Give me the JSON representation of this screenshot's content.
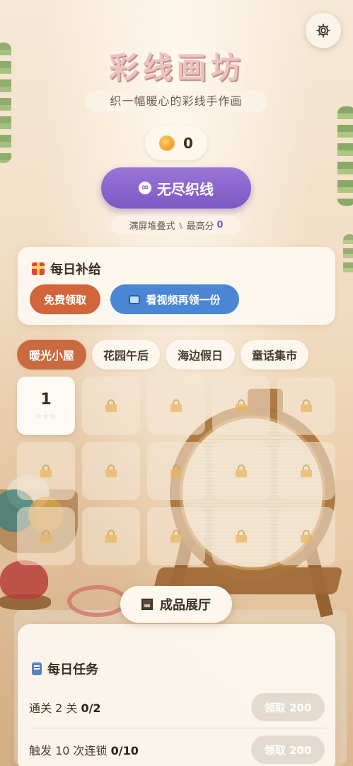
{
  "header": {
    "title": "彩线画坊",
    "subtitle": "织一幅暖心的彩线手作画",
    "settings_icon": "gear-icon"
  },
  "wallet": {
    "coin_icon": "coin-icon",
    "coins": "0"
  },
  "endless": {
    "icon": "infinity-icon",
    "label": "无尽织线",
    "mode_text": "满屏堆叠式 ⑊ 最高分",
    "best_score": "0"
  },
  "daily_supply": {
    "icon": "gift-icon",
    "title": "每日补给",
    "free_label": "免费领取",
    "video_icon": "tv-icon",
    "video_label": "看视频再领一份"
  },
  "chapters": [
    {
      "label": "暖光小屋",
      "active": true
    },
    {
      "label": "花园午后",
      "active": false
    },
    {
      "label": "海边假日",
      "active": false
    },
    {
      "label": "童话集市",
      "active": false
    }
  ],
  "levels": {
    "open": [
      {
        "number": "1",
        "stars": "☆☆☆"
      }
    ],
    "locked_count": 14
  },
  "gallery": {
    "icon": "frame-icon",
    "label": "成品展厅"
  },
  "daily_tasks": {
    "icon": "scroll-icon",
    "title": "每日任务",
    "items": [
      {
        "label": "通关 2 关",
        "progress": "0/2",
        "claim": "领取 200"
      },
      {
        "label": "触发 10 次连锁",
        "progress": "0/10",
        "claim": "领取 200"
      }
    ]
  },
  "colors": {
    "accent_purple": "#7d57c2",
    "free_orange": "#d2663a",
    "video_blue": "#4a86d4",
    "active_tab": "#c96a3f"
  }
}
